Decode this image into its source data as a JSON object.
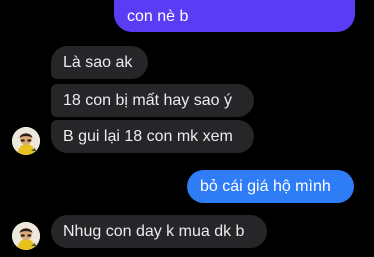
{
  "theme": {
    "background": "#000000",
    "incoming_bubble": "#262629",
    "outgoing_bubble": "#5b3cf5",
    "incoming_text": "#ececee",
    "outgoing_text": "#ffffff"
  },
  "messages": [
    {
      "direction": "outgoing",
      "text": "con nè b"
    },
    {
      "direction": "incoming",
      "text": "Là sao ak"
    },
    {
      "direction": "incoming",
      "text": "18 con bị mất hay sao ý"
    },
    {
      "direction": "incoming",
      "text": "B gui lại 18 con mk xem",
      "avatar": "contact-avatar"
    },
    {
      "direction": "outgoing",
      "text": "bỏ cái giá hộ mình"
    },
    {
      "direction": "incoming",
      "text": "Nhug con day k mua dk b",
      "avatar": "contact-avatar"
    }
  ]
}
